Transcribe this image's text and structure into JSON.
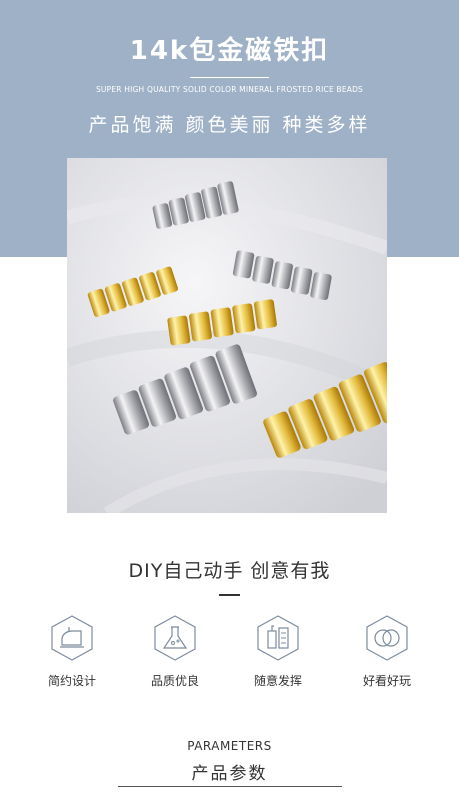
{
  "header": {
    "title": "14k包金磁铁扣",
    "subtitle_en": "SUPER HIGH QUALITY SOLID COLOR MINERAL FROSTED RICE BEADS",
    "slogan": "产品饱满 颜色美丽 种类多样"
  },
  "diy": {
    "headline": "DIY自己动手 创意有我"
  },
  "features": [
    {
      "label": "简约设计",
      "icon": "iron-icon"
    },
    {
      "label": "品质优良",
      "icon": "flask-icon"
    },
    {
      "label": "随意发挥",
      "icon": "tools-icon"
    },
    {
      "label": "好看好玩",
      "icon": "rings-icon"
    }
  ],
  "params": {
    "title_en": "PARAMETERS",
    "title_cn": "产品参数"
  },
  "colors": {
    "band": "#9fb1c6",
    "icon_stroke": "#7c8b9c",
    "gold": "#e2b93b",
    "silver": "#c9c9cc"
  }
}
